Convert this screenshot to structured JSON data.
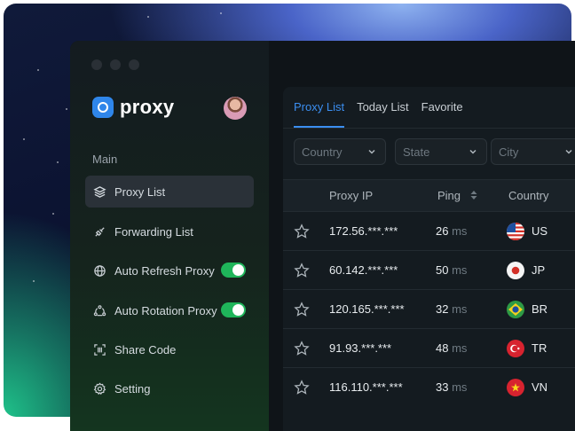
{
  "app": {
    "logo_text": "proxy"
  },
  "sidebar": {
    "section_label": "Main",
    "items": [
      {
        "label": "Proxy List",
        "icon": "layers-icon",
        "active": true,
        "toggle": false
      },
      {
        "label": "Forwarding List",
        "icon": "forward-plug-icon",
        "active": false,
        "toggle": false
      },
      {
        "label": "Auto Refresh Proxy",
        "icon": "globe-icon",
        "active": false,
        "toggle": true
      },
      {
        "label": "Auto Rotation Proxy",
        "icon": "rotation-icon",
        "active": false,
        "toggle": true
      },
      {
        "label": "Share Code",
        "icon": "scan-code-icon",
        "active": false,
        "toggle": false
      },
      {
        "label": "Setting",
        "icon": "gear-icon",
        "active": false,
        "toggle": false
      }
    ]
  },
  "tabs": [
    "Proxy List",
    "Today List",
    "Favorite"
  ],
  "filters": [
    {
      "placeholder": "Country"
    },
    {
      "placeholder": "State"
    },
    {
      "placeholder": "City"
    }
  ],
  "table": {
    "headers": {
      "ip": "Proxy IP",
      "ping": "Ping",
      "country": "Country"
    },
    "unit": "ms",
    "rows": [
      {
        "ip": "172.56.***.***",
        "ping": "26",
        "country": "US"
      },
      {
        "ip": "60.142.***.***",
        "ping": "50",
        "country": "JP"
      },
      {
        "ip": "120.165.***.***",
        "ping": "32",
        "country": "BR"
      },
      {
        "ip": "91.93.***.***",
        "ping": "48",
        "country": "TR"
      },
      {
        "ip": "116.110.***.***",
        "ping": "33",
        "country": "VN"
      }
    ]
  },
  "colors": {
    "accent": "#3b8ef0",
    "toggle_on": "#1fb55a",
    "logo": "#2f86ea"
  }
}
